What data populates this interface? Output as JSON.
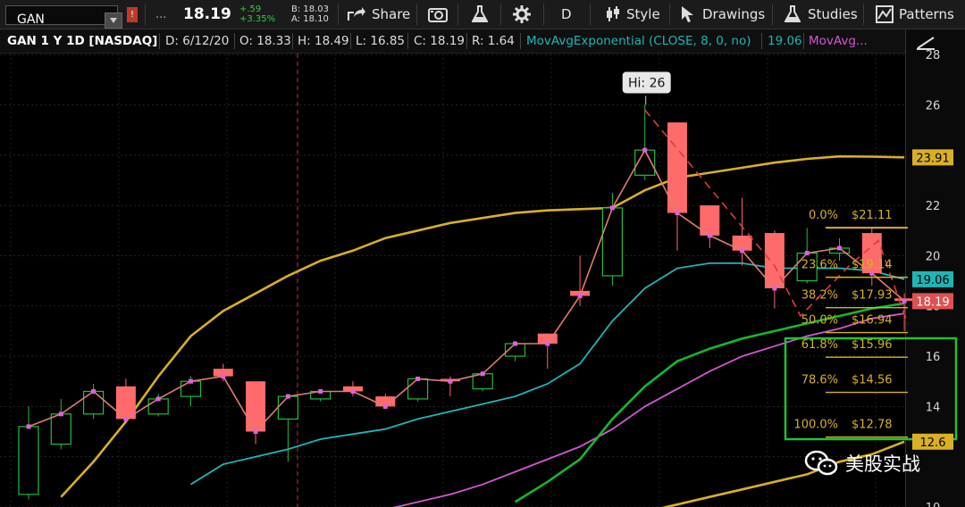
{
  "toolbar": {
    "symbol": "GAN",
    "ellipsis": "...",
    "last": "18.19",
    "change": "+.59",
    "change_pct": "+3.35%",
    "bid": "B: 18.03",
    "ask": "A: 18.10",
    "share": "Share",
    "period": "D",
    "style": "Style",
    "drawings": "Drawings",
    "studies": "Studies",
    "patterns": "Patterns"
  },
  "infobar": {
    "title": "GAN 1 Y 1D [NASDAQ]",
    "date": "D: 6/12/20",
    "open": "O: 18.33",
    "high": "H: 18.49",
    "low": "L: 16.85",
    "close": "C: 18.19",
    "range": "R: 1.64",
    "study1": "MovAvgExponential (CLOSE, 8, 0, no)",
    "study1_value": "19.06",
    "study2": "MovAvg..."
  },
  "colors": {
    "up": "#1fbf3f",
    "down": "#ff6b6b",
    "cyan": "#1fb5b5",
    "magenta": "#d357d3",
    "gold": "#d9b023",
    "green": "#15b82a",
    "dash": "#e0393a",
    "zigzag": "#e07c6e",
    "fib": "#d9b023",
    "box": "#22c036"
  },
  "watermark": "美股实战",
  "chart_data": {
    "type": "candlestick",
    "ylim": [
      10,
      29
    ],
    "yticks": [
      10,
      12,
      14,
      16,
      18,
      20,
      22,
      24,
      26,
      28
    ],
    "hi_annotation": "Hi: 26",
    "price_tags": [
      {
        "label": "23.91",
        "value": 23.91,
        "color": "#d9b023"
      },
      {
        "label": "19.06",
        "value": 19.06,
        "color": "#1fb5b5"
      },
      {
        "label": "18.19",
        "value": 18.19,
        "color": "#e05050"
      },
      {
        "label": "12.6",
        "value": 12.6,
        "color": "#d9b023"
      }
    ],
    "candles": [
      {
        "o": 10.5,
        "h": 14.0,
        "l": 10.3,
        "c": 13.2
      },
      {
        "o": 12.5,
        "h": 14.3,
        "l": 12.3,
        "c": 13.7
      },
      {
        "o": 13.7,
        "h": 14.9,
        "l": 13.5,
        "c": 14.6
      },
      {
        "o": 14.8,
        "h": 15.1,
        "l": 13.4,
        "c": 13.5
      },
      {
        "o": 13.7,
        "h": 14.5,
        "l": 13.6,
        "c": 14.3
      },
      {
        "o": 14.4,
        "h": 15.2,
        "l": 14.0,
        "c": 15.0
      },
      {
        "o": 15.5,
        "h": 15.7,
        "l": 15.0,
        "c": 15.2
      },
      {
        "o": 15.0,
        "h": 15.0,
        "l": 12.5,
        "c": 13.0
      },
      {
        "o": 13.5,
        "h": 14.3,
        "l": 11.8,
        "c": 14.4
      },
      {
        "o": 14.3,
        "h": 14.6,
        "l": 14.2,
        "c": 14.6
      },
      {
        "o": 14.8,
        "h": 15.0,
        "l": 14.4,
        "c": 14.6
      },
      {
        "o": 14.4,
        "h": 14.5,
        "l": 13.9,
        "c": 14.0
      },
      {
        "o": 14.3,
        "h": 15.0,
        "l": 14.2,
        "c": 15.1
      },
      {
        "o": 15.1,
        "h": 15.2,
        "l": 14.4,
        "c": 15.0
      },
      {
        "o": 14.7,
        "h": 15.4,
        "l": 14.6,
        "c": 15.3
      },
      {
        "o": 16.0,
        "h": 16.4,
        "l": 15.8,
        "c": 16.5
      },
      {
        "o": 16.9,
        "h": 16.9,
        "l": 15.5,
        "c": 16.5
      },
      {
        "o": 18.6,
        "h": 20.0,
        "l": 18.0,
        "c": 18.4
      },
      {
        "o": 19.2,
        "h": 22.5,
        "l": 18.8,
        "c": 21.9
      },
      {
        "o": 23.2,
        "h": 26.0,
        "l": 23.0,
        "c": 24.2
      },
      {
        "o": 25.3,
        "h": 25.3,
        "l": 20.2,
        "c": 21.7
      },
      {
        "o": 22.0,
        "h": 22.0,
        "l": 20.3,
        "c": 20.8
      },
      {
        "o": 20.8,
        "h": 22.3,
        "l": 19.6,
        "c": 20.2
      },
      {
        "o": 20.9,
        "h": 21.0,
        "l": 17.9,
        "c": 18.7
      },
      {
        "o": 19.0,
        "h": 21.1,
        "l": 18.9,
        "c": 20.1
      },
      {
        "o": 20.1,
        "h": 20.7,
        "l": 19.8,
        "c": 20.3
      },
      {
        "o": 20.9,
        "h": 21.1,
        "l": 18.8,
        "c": 19.3
      },
      {
        "o": 18.3,
        "h": 18.5,
        "l": 17.0,
        "c": 18.2
      }
    ],
    "series": [
      {
        "name": "MovAvgExponential (CLOSE, 8, 0, no)",
        "color": "#1fb5b5",
        "values": [
          null,
          null,
          null,
          null,
          null,
          10.9,
          11.7,
          12.0,
          12.3,
          12.7,
          12.9,
          13.1,
          13.5,
          13.8,
          14.1,
          14.4,
          14.9,
          15.7,
          17.4,
          18.7,
          19.5,
          19.7,
          19.7,
          19.5,
          19.5,
          19.5,
          19.4,
          19.06
        ]
      },
      {
        "name": "",
        "color": "#d357d3",
        "values": [
          null,
          null,
          null,
          null,
          null,
          null,
          null,
          null,
          null,
          null,
          null,
          9.9,
          10.2,
          10.5,
          10.9,
          11.4,
          11.9,
          12.4,
          13.1,
          14.0,
          14.7,
          15.4,
          16.0,
          16.4,
          16.8,
          17.1,
          17.5,
          17.7
        ]
      },
      {
        "name": "",
        "color": "#15b82a",
        "values": [
          null,
          null,
          null,
          null,
          null,
          null,
          null,
          null,
          null,
          null,
          null,
          null,
          null,
          null,
          null,
          10.2,
          11.0,
          11.9,
          13.5,
          14.8,
          15.8,
          16.3,
          16.7,
          17.0,
          17.3,
          17.6,
          17.9,
          18.1
        ]
      },
      {
        "name": "",
        "color": "#d9b023",
        "values": [
          null,
          10.4,
          11.8,
          13.4,
          15.2,
          16.8,
          17.8,
          18.5,
          19.2,
          19.8,
          20.2,
          20.7,
          21.0,
          21.3,
          21.5,
          21.7,
          21.8,
          21.85,
          21.9,
          22.6,
          23.1,
          23.3,
          23.5,
          23.7,
          23.85,
          23.95,
          23.94,
          23.91
        ]
      },
      {
        "name": "",
        "color": "#d9b023",
        "values": [
          null,
          null,
          null,
          null,
          null,
          null,
          null,
          null,
          null,
          null,
          null,
          null,
          null,
          null,
          null,
          null,
          null,
          null,
          null,
          9.8,
          10.1,
          10.4,
          10.7,
          11.0,
          11.3,
          11.8,
          12.1,
          12.6
        ]
      }
    ],
    "fibonacci": [
      {
        "label": "0.0%",
        "price_label": "$21.11",
        "value": 21.11
      },
      {
        "label": "23.6%",
        "price_label": "$19.14",
        "value": 19.14
      },
      {
        "label": "38.2%",
        "price_label": "$17.93",
        "value": 17.93
      },
      {
        "label": "50.0%",
        "price_label": "$16.94",
        "value": 16.94
      },
      {
        "label": "61.8%",
        "price_label": "$15.96",
        "value": 15.96
      },
      {
        "label": "78.6%",
        "price_label": "$14.56",
        "value": 14.56
      },
      {
        "label": "100.0%",
        "price_label": "$12.78",
        "value": 12.78
      }
    ]
  }
}
